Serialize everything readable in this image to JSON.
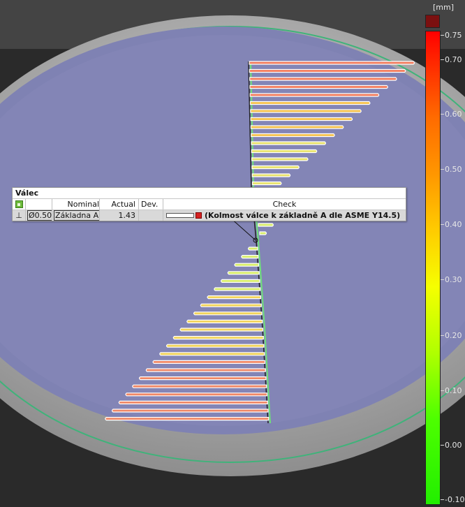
{
  "annotation": {
    "title": "Válec",
    "columns": {
      "nominal": "Nominal",
      "actual": "Actual",
      "dev": "Dev.",
      "check": "Check"
    },
    "row": {
      "symbol": "⊥",
      "tolerance": "Ø0.50",
      "datum": "Základna A",
      "actual": "1.43",
      "dev": "",
      "check_label": "(Kolmost válce k základně A dle ASME Y14.5)",
      "status_color": "#d42121"
    }
  },
  "color_scale": {
    "unit": "[mm]",
    "over_color": "#7b1010",
    "ticks": [
      "0.75",
      "0.70",
      "0.60",
      "0.50",
      "0.40",
      "0.30",
      "0.20",
      "0.10",
      "0.00",
      "-0.10"
    ]
  }
}
